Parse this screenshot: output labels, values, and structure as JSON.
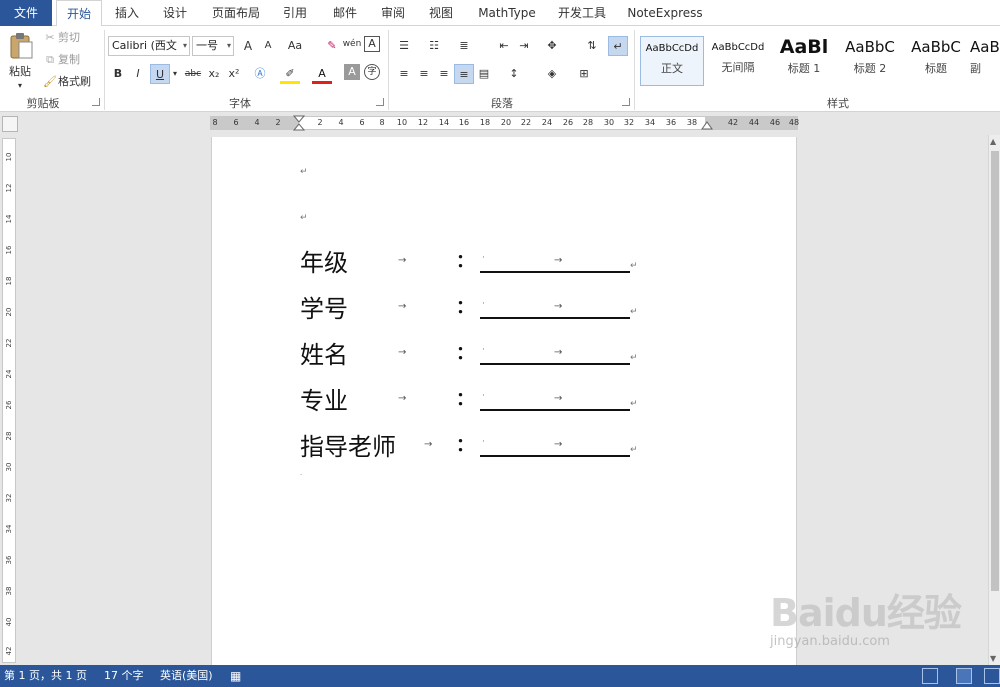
{
  "tabs": [
    "文件",
    "开始",
    "插入",
    "设计",
    "页面布局",
    "引用",
    "邮件",
    "审阅",
    "视图",
    "MathType",
    "开发工具",
    "NoteExpress"
  ],
  "active_tab": "开始",
  "clipboard": {
    "paste": "粘贴",
    "cut": "剪切",
    "copy": "复制",
    "format_painter": "格式刷",
    "label": "剪贴板"
  },
  "font": {
    "name": "Calibri (西文",
    "size": "一号",
    "grow": "A",
    "shrink": "A",
    "case": "Aa",
    "phonetic": "wén",
    "bold": "B",
    "italic": "I",
    "underline": "U",
    "strike": "abc",
    "subscript": "x₂",
    "superscript": "x²",
    "font_color": "A",
    "char_shading": "A",
    "enclose": "字",
    "label": "字体"
  },
  "paragraph": {
    "label": "段落"
  },
  "styles": {
    "label": "样式",
    "items": [
      {
        "sample": "AaBbCcDd",
        "name": "正文"
      },
      {
        "sample": "AaBbCcDd",
        "name": "无间隔"
      },
      {
        "sample": "AaBl",
        "name": "标题 1"
      },
      {
        "sample": "AaBbC",
        "name": "标题 2"
      },
      {
        "sample": "AaBbC",
        "name": "标题"
      },
      {
        "sample": "AaB",
        "name": "副"
      }
    ]
  },
  "ruler": {
    "h_numbers": [
      "8",
      "6",
      "4",
      "2",
      "2",
      "4",
      "6",
      "8",
      "10",
      "12",
      "14",
      "16",
      "18",
      "20",
      "22",
      "24",
      "26",
      "28",
      "30",
      "32",
      "34",
      "36",
      "38",
      "42",
      "44",
      "46",
      "48"
    ],
    "v_numbers": [
      "10",
      "12",
      "14",
      "16",
      "18",
      "20",
      "22",
      "24",
      "26",
      "28",
      "30",
      "32",
      "34",
      "36",
      "38",
      "40",
      "42"
    ]
  },
  "document": {
    "paragraph_mark": "↵",
    "tab_mark": "→",
    "colon": "：",
    "rows": [
      {
        "label": "年级"
      },
      {
        "label": "学号"
      },
      {
        "label": "姓名"
      },
      {
        "label": "专业"
      },
      {
        "label": "指导老师"
      }
    ]
  },
  "status": {
    "page": "第 1 页，共 1 页",
    "words": "17 个字",
    "language": "英语(美国)"
  },
  "watermark": {
    "brand": "Baidu经验",
    "site": "jingyan.baidu.com"
  },
  "colors": {
    "accent": "#2b579a",
    "ribbon": "#ffffff",
    "canvas": "#e6e6e6"
  }
}
